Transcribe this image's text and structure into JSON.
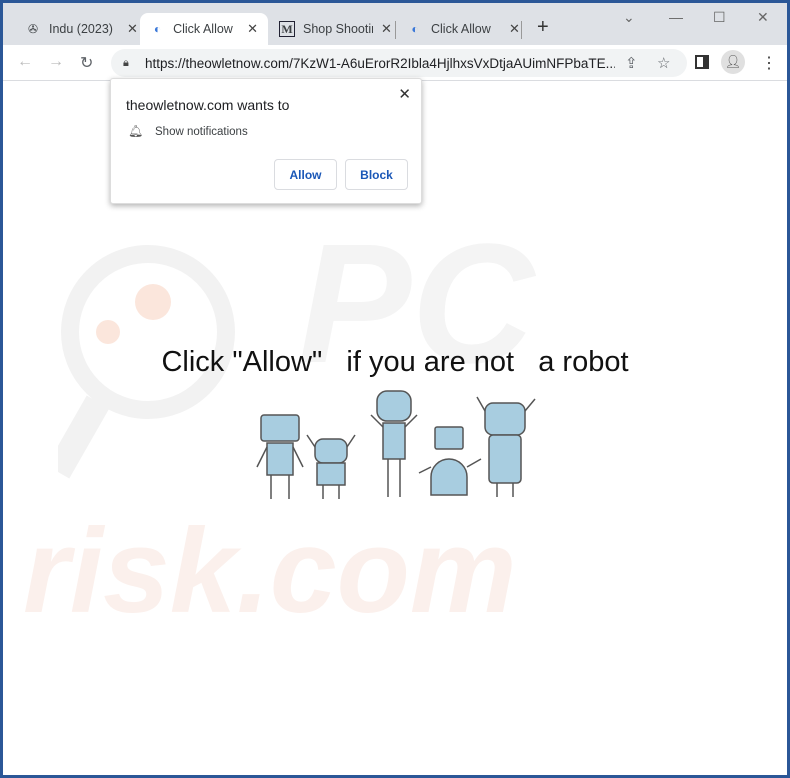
{
  "tabs": [
    {
      "title": "Indu (2023)",
      "icon": "film-reel-icon",
      "active": false
    },
    {
      "title": "Click Allow",
      "icon": "loading-favicon-icon",
      "active": true
    },
    {
      "title": "Shop Shooting",
      "icon": "m-logo-icon",
      "active": false
    },
    {
      "title": "Click Allow",
      "icon": "loading-favicon-icon",
      "active": false
    }
  ],
  "toolbar": {
    "url": "https://theowletnow.com/7KzW1-A6uErorR2Ibla4HjlhxsVxDtjaAUimNFPbaTE..."
  },
  "popup": {
    "title": "theowletnow.com wants to",
    "permission": "Show notifications",
    "allow": "Allow",
    "block": "Block"
  },
  "page": {
    "headline": "Click \"Allow\"   if you are not   a robot",
    "watermark": "risk.com"
  },
  "colors": {
    "frame": "#2b5797",
    "button_text": "#1a57b7",
    "robot": "#a8cde0"
  }
}
